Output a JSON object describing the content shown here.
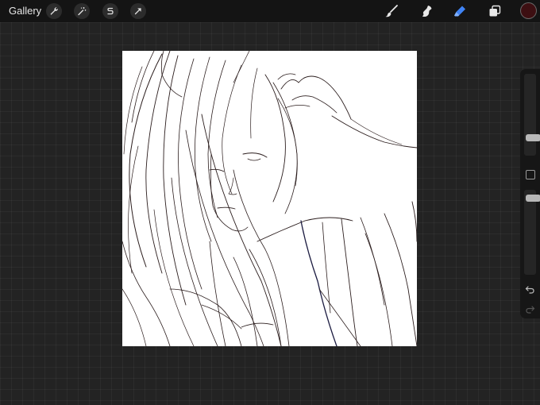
{
  "topbar": {
    "gallery_label": "Gallery",
    "left_tools": [
      "wrench-icon",
      "magic-wand-icon",
      "selection-icon",
      "transform-arrow-icon"
    ],
    "right_tools": [
      "brush-icon",
      "smudge-icon",
      "eraser-icon",
      "layers-icon"
    ],
    "active_tool": "eraser-icon",
    "active_color": "#3d0f12",
    "accent_color": "#3f83f5"
  },
  "sidebar": {
    "brush_size_level": 0.3,
    "opacity_level": 0.6,
    "controls": [
      "modify-square-icon",
      "undo-icon",
      "redo-icon"
    ]
  }
}
